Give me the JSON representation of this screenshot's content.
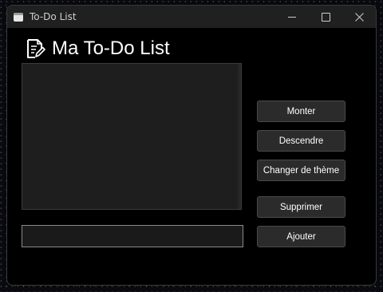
{
  "window": {
    "title": "To-Do List"
  },
  "header": {
    "title": "Ma To-Do List",
    "icon": "note-edit-icon"
  },
  "tasks": {
    "items": []
  },
  "entry": {
    "value": "",
    "placeholder": ""
  },
  "buttons": {
    "up": "Monter",
    "down": "Descendre",
    "theme": "Changer de thème",
    "delete": "Supprimer",
    "add": "Ajouter"
  },
  "colors": {
    "window_bg": "#000000",
    "titlebar_bg": "#202020",
    "button_bg": "#2b2b2b",
    "list_bg": "#1e1e1e"
  }
}
